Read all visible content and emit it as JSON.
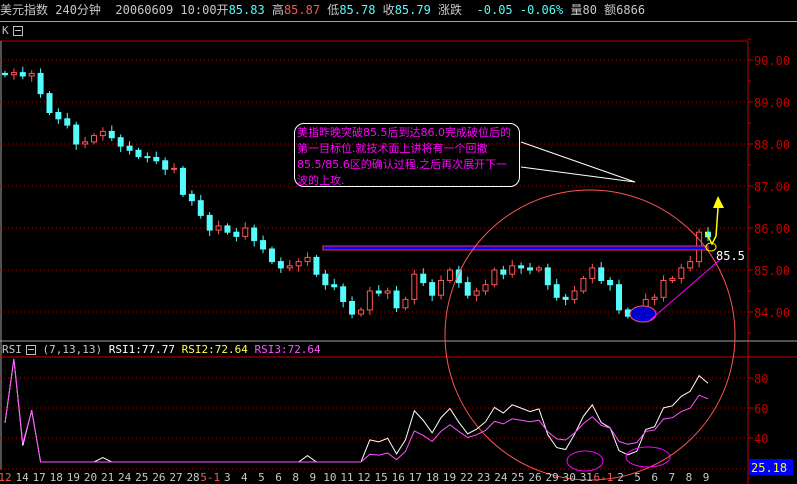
{
  "header": {
    "name": "美元指数",
    "period": "240分钟",
    "date": "20060609",
    "time": "10:00",
    "open_label": "开",
    "open": "85.83",
    "high_label": "高",
    "high": "85.87",
    "low_label": "低",
    "low": "85.78",
    "close_label": "收",
    "close": "85.79",
    "change_label": "涨跌",
    "change": "-0.05",
    "change_pct": "-0.06%",
    "volume_label": "量80",
    "amount_label": "额6866"
  },
  "main_panel": {
    "tag": "K",
    "annotation_lines": [
      "美指昨晚突破85.5后到达86.0完成破位后的",
      "第一目标位.就技术面上讲将有一个回撤",
      "85.5/85.6区的确认过程.之后再次展开下一",
      "波的上攻."
    ],
    "level_label": "85.5",
    "level": 85.5
  },
  "colors": {
    "up": "#ff5454",
    "down": "#54fcfc",
    "axis": "#c00000",
    "rsi1": "#ffffff",
    "rsi2": "#ffff54",
    "rsi3": "#ff54ff",
    "annotation": "#ff00ff"
  },
  "rsi_panel": {
    "name": "RSI",
    "params": "(7,13,13)",
    "rsi1": "RSI1:77.77",
    "rsi2": "RSI2:72.64",
    "rsi3": "RSI3:72.64",
    "current": "25.18"
  },
  "chart_data": {
    "type": "candlestick",
    "y_ticks": [
      "90.00",
      "89.00",
      "88.00",
      "87.00",
      "86.00",
      "85.00",
      "84.00"
    ],
    "ylim": [
      83.3,
      90.7
    ],
    "rsi_ticks": [
      "80",
      "60",
      "40"
    ],
    "rsi_lim": [
      16,
      86
    ],
    "close": [
      89.65,
      89.7,
      89.62,
      89.68,
      89.2,
      88.75,
      88.6,
      88.45,
      88.0,
      88.05,
      88.2,
      88.3,
      88.15,
      87.95,
      87.85,
      87.7,
      87.68,
      87.6,
      87.4,
      87.42,
      86.8,
      86.65,
      86.3,
      85.95,
      86.05,
      85.9,
      85.8,
      86.0,
      85.7,
      85.5,
      85.2,
      85.05,
      85.1,
      85.2,
      85.3,
      84.9,
      84.65,
      84.6,
      84.25,
      83.95,
      84.05,
      84.5,
      84.45,
      84.5,
      84.1,
      84.3,
      84.9,
      84.7,
      84.4,
      84.75,
      85.0,
      84.7,
      84.4,
      84.5,
      84.65,
      85.0,
      84.9,
      85.1,
      85.05,
      85.0,
      85.05,
      84.65,
      84.35,
      84.3,
      84.5,
      84.8,
      85.05,
      84.75,
      84.65,
      84.05,
      83.9,
      83.95,
      84.3,
      84.35,
      84.75,
      84.8,
      85.05,
      85.2,
      85.9,
      85.79
    ],
    "x_labels": [
      {
        "t": "12",
        "red": true
      },
      {
        "t": "14"
      },
      {
        "t": "17"
      },
      {
        "t": "18"
      },
      {
        "t": "19"
      },
      {
        "t": "20"
      },
      {
        "t": "21"
      },
      {
        "t": "24"
      },
      {
        "t": "25"
      },
      {
        "t": "26"
      },
      {
        "t": "27"
      },
      {
        "t": "28"
      },
      {
        "t": "5-1",
        "red": true
      },
      {
        "t": "3"
      },
      {
        "t": "4"
      },
      {
        "t": "5"
      },
      {
        "t": "6"
      },
      {
        "t": "8"
      },
      {
        "t": "9"
      },
      {
        "t": "10"
      },
      {
        "t": "11"
      },
      {
        "t": "12"
      },
      {
        "t": "15"
      },
      {
        "t": "16"
      },
      {
        "t": "17"
      },
      {
        "t": "18"
      },
      {
        "t": "19"
      },
      {
        "t": "22"
      },
      {
        "t": "23"
      },
      {
        "t": "24"
      },
      {
        "t": "25"
      },
      {
        "t": "26"
      },
      {
        "t": "29"
      },
      {
        "t": "30"
      },
      {
        "t": "31"
      },
      {
        "t": "6-1",
        "red": true
      },
      {
        "t": "2"
      },
      {
        "t": "5"
      },
      {
        "t": "6"
      },
      {
        "t": "7"
      },
      {
        "t": "8"
      },
      {
        "t": "9"
      }
    ]
  }
}
